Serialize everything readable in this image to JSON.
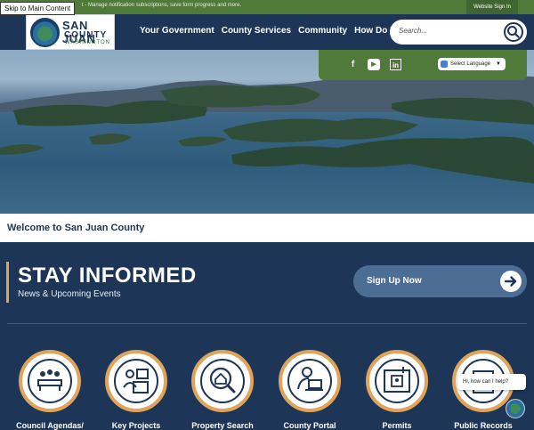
{
  "skip_link": "Skip to Main Content",
  "topbar": {
    "message": "t - Manage notification subscriptions, save form progress and more.",
    "signin_label": "Website Sign In"
  },
  "logo": {
    "line1": "SAN JUAN",
    "line2": "COUNTY",
    "line3": "WASHINGTON"
  },
  "nav": [
    "Your Government",
    "County Services",
    "Community",
    "How Do I..."
  ],
  "search": {
    "placeholder": "Search..."
  },
  "social": {
    "icons": [
      "facebook-icon",
      "youtube-icon",
      "linkedin-icon"
    ],
    "language_label": "Select Language"
  },
  "welcome": "Welcome to San Juan County",
  "stay_informed": {
    "title": "STAY INFORMED",
    "subtitle": "News & Upcoming Events",
    "signup_label": "Sign Up Now"
  },
  "tiles": [
    {
      "label": "Council Agendas/",
      "icon": "meeting-icon"
    },
    {
      "label": "Key Projects",
      "icon": "projects-icon"
    },
    {
      "label": "Property Search",
      "icon": "house-search-icon"
    },
    {
      "label": "County Portal",
      "icon": "portal-user-icon"
    },
    {
      "label": "Permits",
      "icon": "permits-icon"
    },
    {
      "label": "Public Records",
      "icon": "records-icon"
    }
  ],
  "chat": {
    "prompt": "Hi, how can I help?"
  },
  "colors": {
    "navy": "#1d3557",
    "green": "#4f7a3a",
    "gold": "#e0a35a",
    "button": "#4c6e95"
  }
}
